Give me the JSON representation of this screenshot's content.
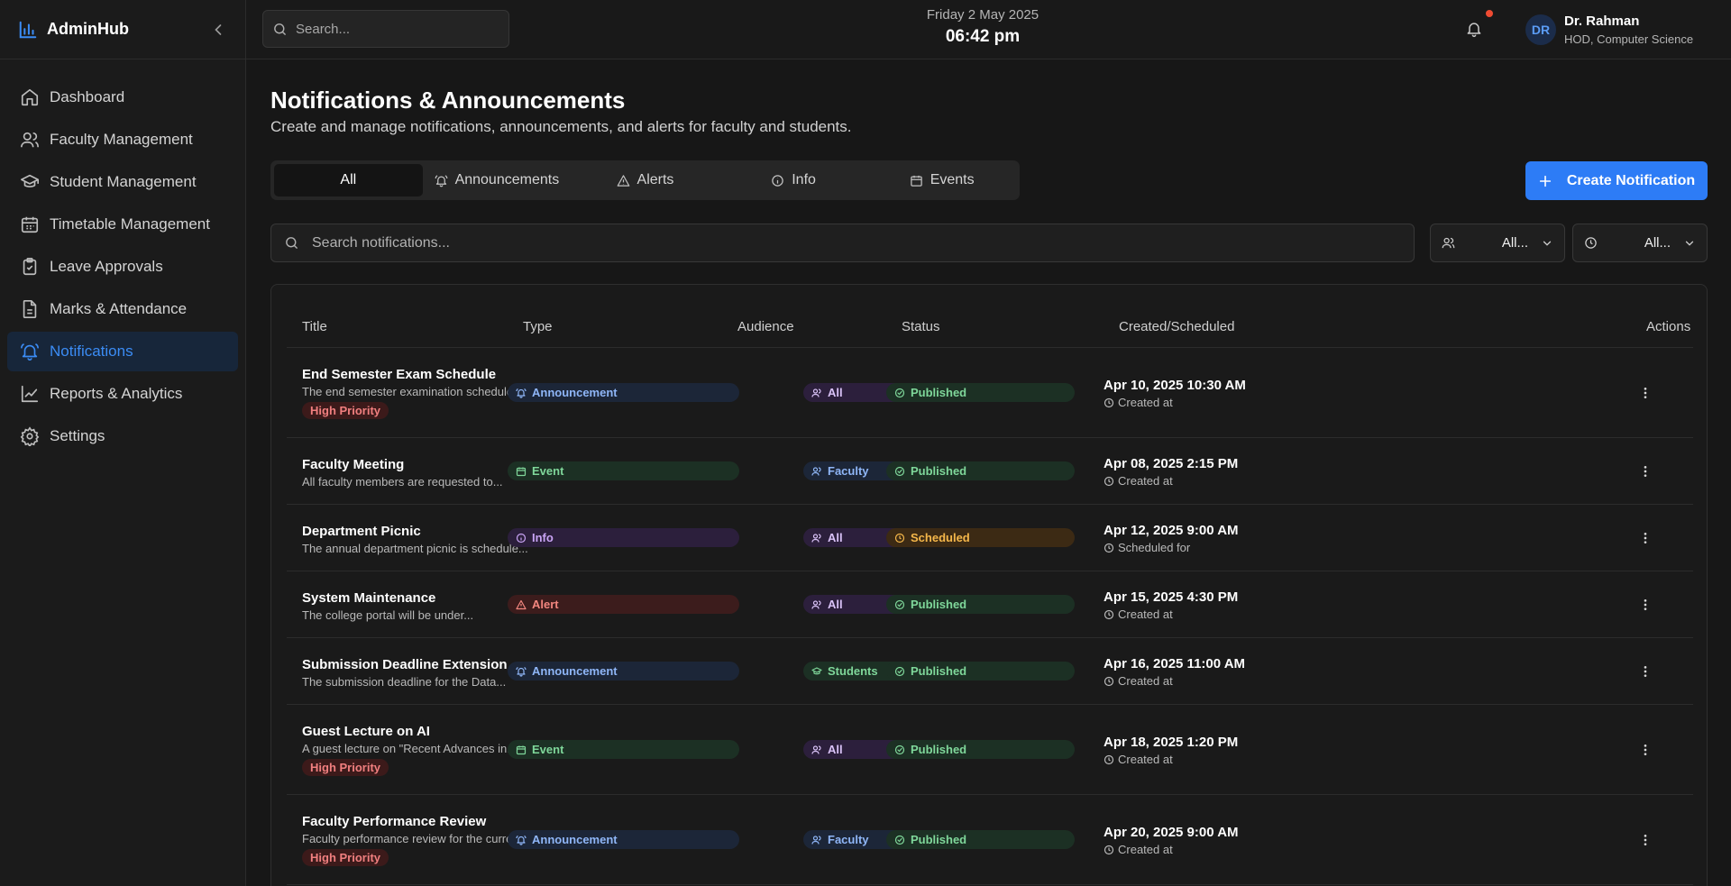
{
  "brand": {
    "name": "AdminHub"
  },
  "sidebar": {
    "items": [
      {
        "label": "Dashboard"
      },
      {
        "label": "Faculty Management"
      },
      {
        "label": "Student Management"
      },
      {
        "label": "Timetable Management"
      },
      {
        "label": "Leave Approvals"
      },
      {
        "label": "Marks & Attendance"
      },
      {
        "label": "Notifications"
      },
      {
        "label": "Reports & Analytics"
      },
      {
        "label": "Settings"
      }
    ],
    "active": "Notifications"
  },
  "header": {
    "search_placeholder": "Search...",
    "date": "Friday 2 May 2025",
    "time": "06:42 pm",
    "user": {
      "initials": "DR",
      "name": "Dr. Rahman",
      "role": "HOD, Computer Science"
    }
  },
  "page": {
    "title": "Notifications & Announcements",
    "subtitle": "Create and manage notifications, announcements, and alerts for faculty and students.",
    "tabs": [
      {
        "label": "All"
      },
      {
        "label": "Announcements"
      },
      {
        "label": "Alerts"
      },
      {
        "label": "Info"
      },
      {
        "label": "Events"
      }
    ],
    "active_tab": "All",
    "create_label": "Create Notification",
    "search_placeholder": "Search notifications...",
    "filters": {
      "audience": "All...",
      "time": "All..."
    }
  },
  "table": {
    "headers": {
      "title": "Title",
      "type": "Type",
      "audience": "Audience",
      "status": "Status",
      "created": "Created/Scheduled",
      "actions": "Actions"
    },
    "rows": [
      {
        "title": "End Semester Exam Schedule",
        "desc": "The end semester examination schedule...",
        "priority": "High Priority",
        "type": "Announcement",
        "audience": "All",
        "status": "Published",
        "date": "Apr 10, 2025 10:30 AM",
        "date_note": "Created at"
      },
      {
        "title": "Faculty Meeting",
        "desc": "All faculty members are requested to...",
        "priority": "",
        "type": "Event",
        "audience": "Faculty",
        "status": "Published",
        "date": "Apr 08, 2025 2:15 PM",
        "date_note": "Created at"
      },
      {
        "title": "Department Picnic",
        "desc": "The annual department picnic is schedule...",
        "priority": "",
        "type": "Info",
        "audience": "All",
        "status": "Scheduled",
        "date": "Apr 12, 2025 9:00 AM",
        "date_note": "Scheduled for"
      },
      {
        "title": "System Maintenance",
        "desc": "The college portal will be under...",
        "priority": "",
        "type": "Alert",
        "audience": "All",
        "status": "Published",
        "date": "Apr 15, 2025 4:30 PM",
        "date_note": "Created at"
      },
      {
        "title": "Submission Deadline Extension",
        "desc": "The submission deadline for the Data...",
        "priority": "",
        "type": "Announcement",
        "audience": "Students",
        "status": "Published",
        "date": "Apr 16, 2025 11:00 AM",
        "date_note": "Created at"
      },
      {
        "title": "Guest Lecture on AI",
        "desc": "A guest lecture on \"Recent Advances in...",
        "priority": "High Priority",
        "type": "Event",
        "audience": "All",
        "status": "Published",
        "date": "Apr 18, 2025 1:20 PM",
        "date_note": "Created at"
      },
      {
        "title": "Faculty Performance Review",
        "desc": "Faculty performance review for the curren...",
        "priority": "High Priority",
        "type": "Announcement",
        "audience": "Faculty",
        "status": "Published",
        "date": "Apr 20, 2025 9:00 AM",
        "date_note": "Created at"
      }
    ]
  },
  "colors": {
    "accent": "#2d7cf6",
    "active_nav_bg": "#17263a",
    "notification_dot": "#ef4b32"
  }
}
